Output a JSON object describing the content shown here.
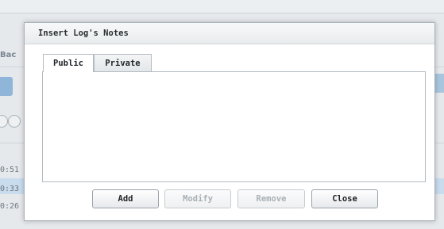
{
  "background": {
    "back_label": "Bac",
    "times": [
      "0:51",
      "0:33",
      "0:26"
    ]
  },
  "dialog": {
    "title": "Insert Log's Notes",
    "tabs": [
      {
        "label": "Public",
        "active": true
      },
      {
        "label": "Private",
        "active": false
      }
    ],
    "notes_value": "",
    "buttons": {
      "add": "Add",
      "modify": "Modify",
      "remove": "Remove",
      "close": "Close"
    },
    "disabled_buttons": [
      "Modify",
      "Remove"
    ]
  },
  "colors": {
    "dialog_bg": "#ffffff",
    "overlay_bg": "#e6e9ec",
    "row_highlight": "#c9dcee",
    "disabled_text": "#a9b0b5"
  }
}
